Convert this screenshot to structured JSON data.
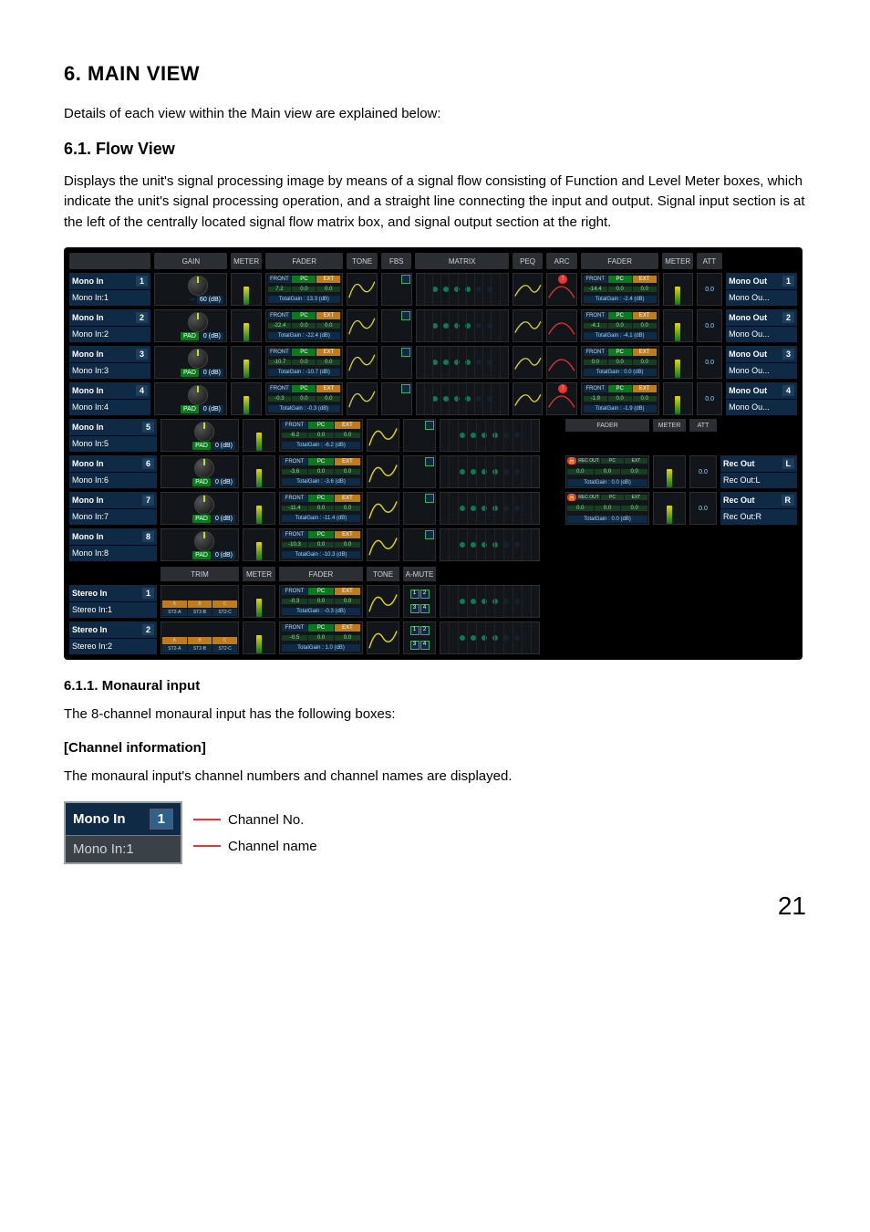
{
  "heading": "6. MAIN VIEW",
  "intro": "Details of each view within the Main view are explained below:",
  "flow_heading": "6.1. Flow View",
  "flow_body": "Displays the unit's signal processing image by means of a signal flow consisting of Function and Level Meter boxes, which indicate the unit's signal processing operation, and a straight line connecting the input and output. Signal input section is at the left of the centrally located signal flow matrix box, and signal output section at the right.",
  "columns_in": [
    "GAIN",
    "METER",
    "FADER",
    "TONE",
    "FBS",
    "MATRIX",
    "PEQ",
    "ARC",
    "FADER",
    "METER",
    "ATT"
  ],
  "columns_mid": [
    "TRIM",
    "METER",
    "FADER",
    "TONE",
    "A-MUTE"
  ],
  "mono_inputs": [
    {
      "num": "1",
      "short": "Mono In",
      "name": "Mono In:1",
      "pad": "60 (dB)",
      "padtype": "60",
      "fader": {
        "front": "7.2",
        "pc": "0.0",
        "ext": "0.0",
        "total": "TotalGain : 13.3 (dB)"
      }
    },
    {
      "num": "2",
      "short": "Mono In",
      "name": "Mono In:2",
      "pad": "0 (dB)",
      "padtype": "PAD",
      "fader": {
        "front": "-22.4",
        "pc": "0.0",
        "ext": "0.0",
        "total": "TotalGain : -22.4 (dB)"
      }
    },
    {
      "num": "3",
      "short": "Mono In",
      "name": "Mono In:3",
      "pad": "0 (dB)",
      "padtype": "PAD",
      "fader": {
        "front": "-10.7",
        "pc": "0.0",
        "ext": "0.0",
        "total": "TotalGain : -10.7 (dB)"
      }
    },
    {
      "num": "4",
      "short": "Mono In",
      "name": "Mono In:4",
      "pad": "0 (dB)",
      "padtype": "PAD",
      "fader": {
        "front": "-0.3",
        "pc": "0.0",
        "ext": "0.0",
        "total": "TotalGain : -0.3 (dB)"
      }
    },
    {
      "num": "5",
      "short": "Mono In",
      "name": "Mono In:5",
      "pad": "0 (dB)",
      "padtype": "PAD",
      "fader": {
        "front": "-6.2",
        "pc": "0.0",
        "ext": "0.0",
        "total": "TotalGain : -6.2 (dB)"
      }
    },
    {
      "num": "6",
      "short": "Mono In",
      "name": "Mono In:6",
      "pad": "0 (dB)",
      "padtype": "PAD",
      "fader": {
        "front": "-3.6",
        "pc": "0.0",
        "ext": "0.0",
        "total": "TotalGain : -3.6 (dB)"
      }
    },
    {
      "num": "7",
      "short": "Mono In",
      "name": "Mono In:7",
      "pad": "0 (dB)",
      "padtype": "PAD",
      "fader": {
        "front": "-11.4",
        "pc": "0.0",
        "ext": "0.0",
        "total": "TotalGain : -11.4 (dB)"
      }
    },
    {
      "num": "8",
      "short": "Mono In",
      "name": "Mono In:8",
      "pad": "0 (dB)",
      "padtype": "PAD",
      "fader": {
        "front": "-10.3",
        "pc": "0.0",
        "ext": "0.0",
        "total": "TotalGain : -10.3 (dB)"
      }
    }
  ],
  "mono_outputs": [
    {
      "num": "1",
      "short": "Mono Out",
      "name": "Mono Ou...",
      "att": "0.0",
      "fader": {
        "front": "-14.4",
        "pc": "0.0",
        "ext": "0.0",
        "total": "TotalGain : -2.4 (dB)"
      },
      "arc_warn": true
    },
    {
      "num": "2",
      "short": "Mono Out",
      "name": "Mono Ou...",
      "att": "0.0",
      "fader": {
        "front": "-4.1",
        "pc": "0.0",
        "ext": "0.0",
        "total": "TotalGain : -4.1 (dB)"
      }
    },
    {
      "num": "3",
      "short": "Mono Out",
      "name": "Mono Ou...",
      "att": "0.0",
      "fader": {
        "front": "0.0",
        "pc": "0.0",
        "ext": "0.0",
        "total": "TotalGain : 0.0 (dB)"
      }
    },
    {
      "num": "4",
      "short": "Mono Out",
      "name": "Mono Ou...",
      "att": "0.0",
      "fader": {
        "front": "-1.9",
        "pc": "0.0",
        "ext": "0.0",
        "total": "TotalGain : -1.9 (dB)"
      },
      "arc_warn": true
    }
  ],
  "rec_outputs": [
    {
      "code": "L",
      "short": "Rec Out",
      "name": "Rec Out:L",
      "att": "0.0",
      "rec": "REC OUT",
      "total": "TotalGain : 0.0 (dB)"
    },
    {
      "code": "R",
      "short": "Rec Out",
      "name": "Rec Out:R",
      "att": "0.0",
      "rec": "REC OUT",
      "total": "TotalGain : 0.0 (dB)"
    }
  ],
  "rec_header": [
    "FADER",
    "METER",
    "ATT"
  ],
  "stereo_inputs": [
    {
      "num": "1",
      "short": "Stereo In",
      "name": "Stereo In:1",
      "trims": [
        "ST2-A",
        "ST2-B",
        "ST2-C"
      ],
      "fader": {
        "front": "-0.3",
        "pc": "0.0",
        "ext": "0.0",
        "total": "TotalGain : -0.3 (dB)"
      },
      "amute": [
        "1",
        "2",
        "3",
        "4"
      ]
    },
    {
      "num": "2",
      "short": "Stereo In",
      "name": "Stereo In:2",
      "trims": [
        "ST2-A",
        "ST2-B",
        "ST2-C"
      ],
      "fader": {
        "front": "-0.5",
        "pc": "0.0",
        "ext": "0.0",
        "total": "TotalGain : 1.0 (dB)"
      },
      "amute": [
        "1",
        "2",
        "3",
        "4"
      ]
    }
  ],
  "sub_heading": "6.1.1. Monaural input",
  "sub_body": "The 8-channel monaural input has the following boxes:",
  "chinfo_head": "[Channel information]",
  "chinfo_body": "The monaural input's channel numbers and channel names are displayed.",
  "demo": {
    "label": "Mono In",
    "num": "1",
    "name": "Mono In:1",
    "no_label": "Channel No.",
    "name_label": "Channel name"
  },
  "tag_labels": {
    "front": "FRONT",
    "pc": "PC",
    "ext": "EXT"
  },
  "page": "21"
}
